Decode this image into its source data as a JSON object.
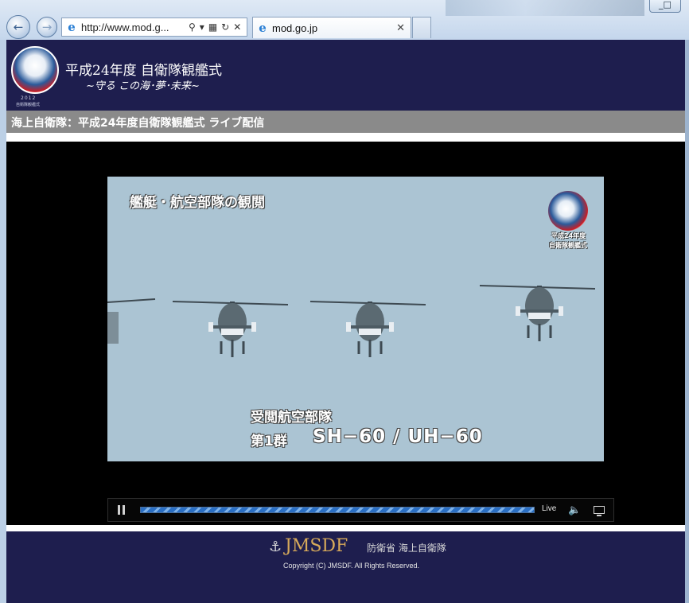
{
  "browser": {
    "address_text": "http://www.mod.g...",
    "tab_title": "mod.go.jp",
    "window_button": "_□"
  },
  "header": {
    "title": "平成24年度 自衛隊観艦式",
    "subtitle": "~守る この海･夢･未来~",
    "logo_year": "2012",
    "logo_caption": "自衛隊観艦式"
  },
  "title_bar": {
    "text": "海上自衛隊：平成24年度自衛隊観艦式 ライブ配信"
  },
  "video": {
    "caption_top": "艦艇・航空部隊の観閲",
    "caption_line1": "受閲航空部隊",
    "caption_line2_prefix": "第1群",
    "caption_line2": "SH−60 / UH−60",
    "logo_line1": "平成24年度",
    "logo_line2": "自衛隊観艦式"
  },
  "player": {
    "live_label": "Live",
    "progress": 1.0
  },
  "footer": {
    "brand": "JMSDF",
    "ministry": "防衛省 海上自衛隊",
    "copyright": "Copyright (C) JMSDF. All Rights Reserved."
  },
  "icons": [
    "back-arrow-icon",
    "forward-arrow-icon",
    "ie-logo-icon",
    "search-icon",
    "dropdown-arrow-icon",
    "compatibility-view-icon",
    "refresh-icon",
    "stop-icon",
    "close-icon",
    "pause-icon",
    "volume-icon",
    "fullscreen-icon",
    "anchor-icon"
  ]
}
